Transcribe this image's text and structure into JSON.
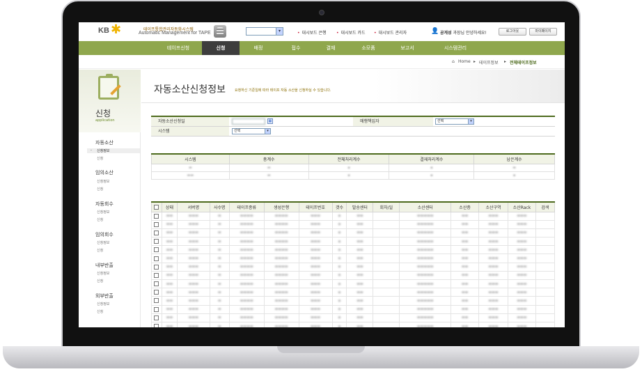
{
  "header": {
    "logo_kb": "KB",
    "system_title_ko": "테이프통합관리자동화시스템",
    "system_title_en": "Automatic Management for TAPE",
    "dashboard_links": [
      "대시보드 은행",
      "대시보드 카드",
      "대시보드 관리자"
    ],
    "user_name": "공게성",
    "user_greeting": "과장님 안녕하세요!",
    "logout_label": "로그아웃",
    "mypage_label": "마이페이지"
  },
  "menu": {
    "items": [
      "테이프신청",
      "신청",
      "배정",
      "접수",
      "결재",
      "소모품",
      "보고서",
      "시스템관리"
    ],
    "active": "신청"
  },
  "breadcrumb": {
    "home": "Home",
    "level1": "테이프정보",
    "current": "전체테이프정보"
  },
  "sidebar": {
    "title": "신청",
    "subtitle": "application",
    "groups": [
      {
        "label": "자동소산",
        "items": [
          "신청정보",
          "신청"
        ]
      },
      {
        "label": "임의소산",
        "items": [
          "신청정보",
          "신청"
        ]
      },
      {
        "label": "자동회수",
        "items": [
          "신청정보",
          "신청"
        ]
      },
      {
        "label": "임의회수",
        "items": [
          "신청정보",
          "신청"
        ]
      },
      {
        "label": "내부반출",
        "items": [
          "신청정보",
          "신청"
        ]
      },
      {
        "label": "외부반출",
        "items": [
          "신청정보",
          "신청"
        ]
      }
    ]
  },
  "page": {
    "title": "자동소산신청정보",
    "description": "요청하신 기준일에 따라 테이프 자동 소산을 신청하실 수 있습니다."
  },
  "form": {
    "date_label": "자동소산신청일",
    "vendor_label": "매행책임자",
    "vendor_value": "선택",
    "system_label": "시스템",
    "system_value": "선택"
  },
  "summary": {
    "columns": [
      "시스템",
      "총계수",
      "전체처리계수",
      "결재처리계수",
      "남은계수"
    ]
  },
  "list": {
    "columns": [
      "상태",
      "서버명",
      "사수명",
      "테이프종류",
      "생성은행",
      "테이프번호",
      "갯수",
      "발송센터",
      "회차/일",
      "소산센터",
      "소산층",
      "소산구역",
      "소산Rack",
      "검색"
    ]
  }
}
